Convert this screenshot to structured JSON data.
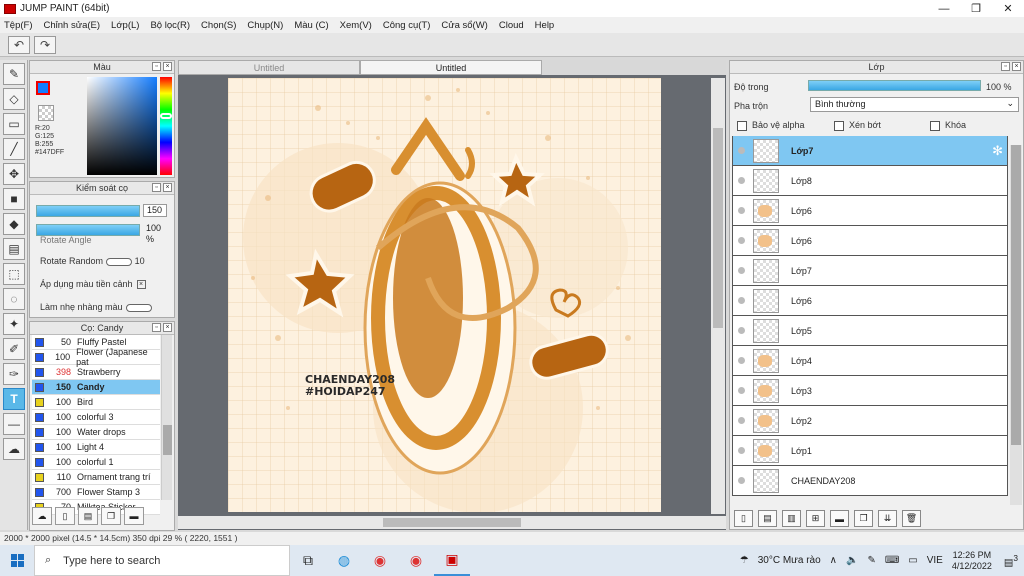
{
  "window": {
    "title": "JUMP PAINT (64bit)",
    "controls": [
      "—",
      "❐",
      "✕"
    ]
  },
  "menu": [
    "Tệp(F)",
    "Chỉnh sửa(E)",
    "Lớp(L)",
    "Bộ lọc(R)",
    "Chọn(S)",
    "Chụp(N)",
    "Màu (C)",
    "Xem(V)",
    "Công cụ(T)",
    "Cửa sổ(W)",
    "Cloud",
    "Help"
  ],
  "toolbar": {
    "undo": "↶",
    "redo": "↷"
  },
  "color_panel": {
    "title": "Màu",
    "primary_color": "#147DFF",
    "rgb_readout": "R:20\nG:125\nB:255\n#147DFF"
  },
  "brush_control": {
    "title": "Kiểm soát cọ",
    "size_value": "150",
    "opacity_value": "100 %",
    "size_fraction": 1.0,
    "opacity_fraction": 1.0,
    "rotate_angle_label": "Rotate Angle",
    "rotate_random_label": "Rotate Random",
    "rotate_random_value": "10",
    "apply_color_label": "Áp dụng màu tiền cảnh",
    "smooth_label": "Làm nhẹ nhàng màu"
  },
  "brush_list": {
    "title": "Cọ: Candy",
    "items": [
      {
        "size": "50",
        "name": "Fluffy Pastel",
        "color": "#2255ee"
      },
      {
        "size": "100",
        "name": "Flower (Japanese pat",
        "color": "#2255ee"
      },
      {
        "size": "398",
        "name": "Strawberry",
        "color": "#2255ee"
      },
      {
        "size": "150",
        "name": "Candy",
        "color": "#2255ee",
        "selected": true
      },
      {
        "size": "100",
        "name": "Bird",
        "color": "#e8d21e"
      },
      {
        "size": "100",
        "name": "colorful 3",
        "color": "#2255ee"
      },
      {
        "size": "100",
        "name": "Water drops",
        "color": "#2255ee"
      },
      {
        "size": "100",
        "name": "Light 4",
        "color": "#2255ee"
      },
      {
        "size": "100",
        "name": "colorful 1",
        "color": "#2255ee"
      },
      {
        "size": "110",
        "name": "Ornament trang trí",
        "color": "#e8d21e"
      },
      {
        "size": "700",
        "name": "Flower Stamp 3",
        "color": "#2255ee"
      },
      {
        "size": "70",
        "name": "Milktea Sticker",
        "color": "#e8d21e"
      }
    ]
  },
  "canvas": {
    "tabs": [
      "Untitled",
      "Untitled"
    ],
    "signature_line1": "CHAENDAY208",
    "signature_line2": "#HOIDAP247"
  },
  "layer_panel": {
    "title": "Lớp",
    "opacity_label": "Độ trong",
    "opacity_value": "100 %",
    "opacity_fraction": 1.0,
    "blend_label": "Pha trộn",
    "blend_value": "Bình thường",
    "protect_alpha": "Bảo vệ alpha",
    "clip": "Xén bớt",
    "lock": "Khóa",
    "layers": [
      {
        "name": "Lớp7",
        "selected": true,
        "thumb": false
      },
      {
        "name": "Lớp8",
        "thumb": false
      },
      {
        "name": "Lớp6",
        "thumb": true
      },
      {
        "name": "Lớp6",
        "thumb": true
      },
      {
        "name": "Lớp7",
        "thumb": false
      },
      {
        "name": "Lớp6",
        "thumb": false
      },
      {
        "name": "Lớp5",
        "thumb": false
      },
      {
        "name": "Lớp4",
        "thumb": true
      },
      {
        "name": "Lớp3",
        "thumb": true
      },
      {
        "name": "Lớp2",
        "thumb": true
      },
      {
        "name": "Lớp1",
        "thumb": true
      },
      {
        "name": "CHAENDAY208",
        "thumb": false
      }
    ]
  },
  "status": {
    "text": "2000 * 2000 pixel   (14.5 * 14.5cm)   350 dpi   29 %   ( 2220, 1551 )"
  },
  "taskbar": {
    "search_placeholder": "Type here to search",
    "weather": "30°C  Mưa rào",
    "lang": "VIE",
    "time": "12:26 PM",
    "date": "4/12/2022",
    "notifications": "3"
  },
  "colors": {
    "accent": "#5ab8e8",
    "artboard": "#fdf1df",
    "artwork": "#c97a1f"
  }
}
